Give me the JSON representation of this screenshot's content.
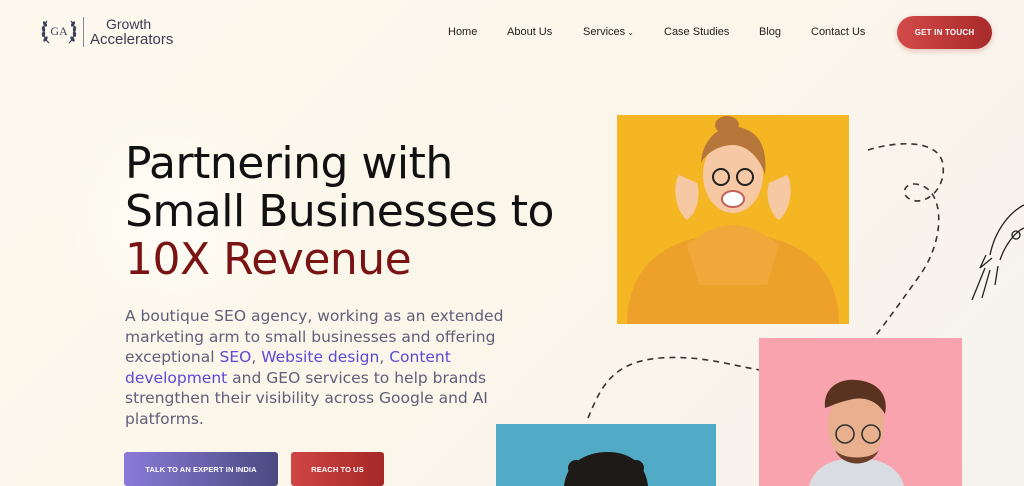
{
  "logo": {
    "initials": "GA",
    "line1": "Growth",
    "line2": "Accelerators"
  },
  "nav": {
    "items": [
      {
        "label": "Home"
      },
      {
        "label": "About Us"
      },
      {
        "label": "Services",
        "has_dropdown": true
      },
      {
        "label": "Case Studies"
      },
      {
        "label": "Blog"
      },
      {
        "label": "Contact Us"
      }
    ],
    "cta": "GET IN TOUCH"
  },
  "hero": {
    "headline_line1": "Partnering with",
    "headline_line2": "Small Businesses to",
    "headline_accent": "10X Revenue",
    "desc_part1": "A boutique SEO agency, working as an extended marketing arm to small businesses and offering exceptional ",
    "link_seo": "SEO",
    "desc_sep1": ", ",
    "link_web": "Website design",
    "desc_sep2": ", ",
    "link_content": "Content development",
    "desc_part2": " and GEO services to help brands strengthen their visibility across Google and AI platforms.",
    "btn_expert": "TALK TO AN EXPERT IN INDIA",
    "btn_reach": "REACH TO US"
  },
  "colors": {
    "accent_red": "#7a1414",
    "cta_red": "#c03a3a",
    "link_purple": "#5a4ad8",
    "yellow_bg": "#f4b623",
    "pink_bg": "#f8a3ad",
    "blue_bg": "#52abc6"
  },
  "icons": [
    "laurel-wreath-icon",
    "chevron-down-icon",
    "rocket-icon"
  ]
}
